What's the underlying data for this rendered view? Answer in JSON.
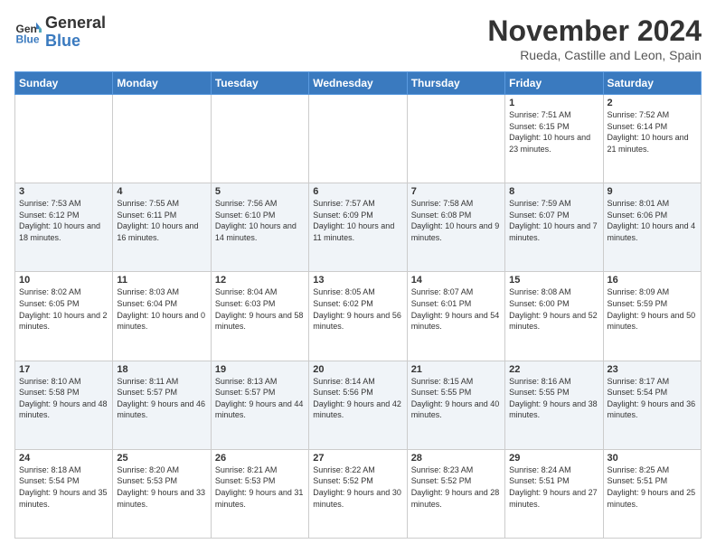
{
  "logo": {
    "line1": "General",
    "line2": "Blue"
  },
  "title": "November 2024",
  "location": "Rueda, Castille and Leon, Spain",
  "days_of_week": [
    "Sunday",
    "Monday",
    "Tuesday",
    "Wednesday",
    "Thursday",
    "Friday",
    "Saturday"
  ],
  "weeks": [
    [
      {
        "day": "",
        "info": ""
      },
      {
        "day": "",
        "info": ""
      },
      {
        "day": "",
        "info": ""
      },
      {
        "day": "",
        "info": ""
      },
      {
        "day": "",
        "info": ""
      },
      {
        "day": "1",
        "info": "Sunrise: 7:51 AM\nSunset: 6:15 PM\nDaylight: 10 hours and 23 minutes."
      },
      {
        "day": "2",
        "info": "Sunrise: 7:52 AM\nSunset: 6:14 PM\nDaylight: 10 hours and 21 minutes."
      }
    ],
    [
      {
        "day": "3",
        "info": "Sunrise: 7:53 AM\nSunset: 6:12 PM\nDaylight: 10 hours and 18 minutes."
      },
      {
        "day": "4",
        "info": "Sunrise: 7:55 AM\nSunset: 6:11 PM\nDaylight: 10 hours and 16 minutes."
      },
      {
        "day": "5",
        "info": "Sunrise: 7:56 AM\nSunset: 6:10 PM\nDaylight: 10 hours and 14 minutes."
      },
      {
        "day": "6",
        "info": "Sunrise: 7:57 AM\nSunset: 6:09 PM\nDaylight: 10 hours and 11 minutes."
      },
      {
        "day": "7",
        "info": "Sunrise: 7:58 AM\nSunset: 6:08 PM\nDaylight: 10 hours and 9 minutes."
      },
      {
        "day": "8",
        "info": "Sunrise: 7:59 AM\nSunset: 6:07 PM\nDaylight: 10 hours and 7 minutes."
      },
      {
        "day": "9",
        "info": "Sunrise: 8:01 AM\nSunset: 6:06 PM\nDaylight: 10 hours and 4 minutes."
      }
    ],
    [
      {
        "day": "10",
        "info": "Sunrise: 8:02 AM\nSunset: 6:05 PM\nDaylight: 10 hours and 2 minutes."
      },
      {
        "day": "11",
        "info": "Sunrise: 8:03 AM\nSunset: 6:04 PM\nDaylight: 10 hours and 0 minutes."
      },
      {
        "day": "12",
        "info": "Sunrise: 8:04 AM\nSunset: 6:03 PM\nDaylight: 9 hours and 58 minutes."
      },
      {
        "day": "13",
        "info": "Sunrise: 8:05 AM\nSunset: 6:02 PM\nDaylight: 9 hours and 56 minutes."
      },
      {
        "day": "14",
        "info": "Sunrise: 8:07 AM\nSunset: 6:01 PM\nDaylight: 9 hours and 54 minutes."
      },
      {
        "day": "15",
        "info": "Sunrise: 8:08 AM\nSunset: 6:00 PM\nDaylight: 9 hours and 52 minutes."
      },
      {
        "day": "16",
        "info": "Sunrise: 8:09 AM\nSunset: 5:59 PM\nDaylight: 9 hours and 50 minutes."
      }
    ],
    [
      {
        "day": "17",
        "info": "Sunrise: 8:10 AM\nSunset: 5:58 PM\nDaylight: 9 hours and 48 minutes."
      },
      {
        "day": "18",
        "info": "Sunrise: 8:11 AM\nSunset: 5:57 PM\nDaylight: 9 hours and 46 minutes."
      },
      {
        "day": "19",
        "info": "Sunrise: 8:13 AM\nSunset: 5:57 PM\nDaylight: 9 hours and 44 minutes."
      },
      {
        "day": "20",
        "info": "Sunrise: 8:14 AM\nSunset: 5:56 PM\nDaylight: 9 hours and 42 minutes."
      },
      {
        "day": "21",
        "info": "Sunrise: 8:15 AM\nSunset: 5:55 PM\nDaylight: 9 hours and 40 minutes."
      },
      {
        "day": "22",
        "info": "Sunrise: 8:16 AM\nSunset: 5:55 PM\nDaylight: 9 hours and 38 minutes."
      },
      {
        "day": "23",
        "info": "Sunrise: 8:17 AM\nSunset: 5:54 PM\nDaylight: 9 hours and 36 minutes."
      }
    ],
    [
      {
        "day": "24",
        "info": "Sunrise: 8:18 AM\nSunset: 5:54 PM\nDaylight: 9 hours and 35 minutes."
      },
      {
        "day": "25",
        "info": "Sunrise: 8:20 AM\nSunset: 5:53 PM\nDaylight: 9 hours and 33 minutes."
      },
      {
        "day": "26",
        "info": "Sunrise: 8:21 AM\nSunset: 5:53 PM\nDaylight: 9 hours and 31 minutes."
      },
      {
        "day": "27",
        "info": "Sunrise: 8:22 AM\nSunset: 5:52 PM\nDaylight: 9 hours and 30 minutes."
      },
      {
        "day": "28",
        "info": "Sunrise: 8:23 AM\nSunset: 5:52 PM\nDaylight: 9 hours and 28 minutes."
      },
      {
        "day": "29",
        "info": "Sunrise: 8:24 AM\nSunset: 5:51 PM\nDaylight: 9 hours and 27 minutes."
      },
      {
        "day": "30",
        "info": "Sunrise: 8:25 AM\nSunset: 5:51 PM\nDaylight: 9 hours and 25 minutes."
      }
    ]
  ]
}
